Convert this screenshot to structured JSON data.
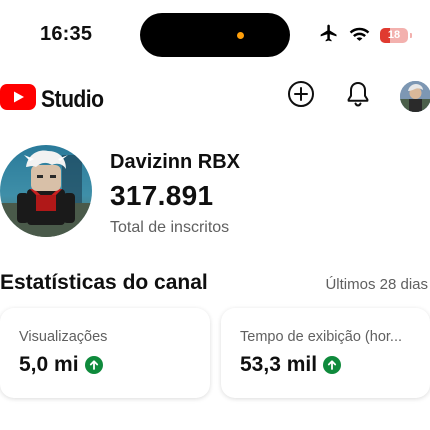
{
  "status_bar": {
    "time": "16:35",
    "battery_level": "18",
    "icons": [
      "airplane-icon",
      "wifi-icon",
      "battery-icon"
    ]
  },
  "header": {
    "logo_text": "Studio",
    "brand_color": "#ff0000",
    "icons": [
      "add-icon",
      "bell-icon",
      "account-avatar"
    ]
  },
  "channel": {
    "name": "Davizinn RBX",
    "subscribers": "317.891",
    "subscribers_label": "Total de inscritos"
  },
  "stats": {
    "title": "Estatísticas do canal",
    "period": "Últimos 28 dias",
    "cards": [
      {
        "label": "Visualizações",
        "value": "5,0 mi",
        "trend": "up"
      },
      {
        "label": "Tempo de exibição (hor...",
        "value": "53,3 mil",
        "trend": "up"
      }
    ],
    "trend_color": "#0f8a3c"
  }
}
